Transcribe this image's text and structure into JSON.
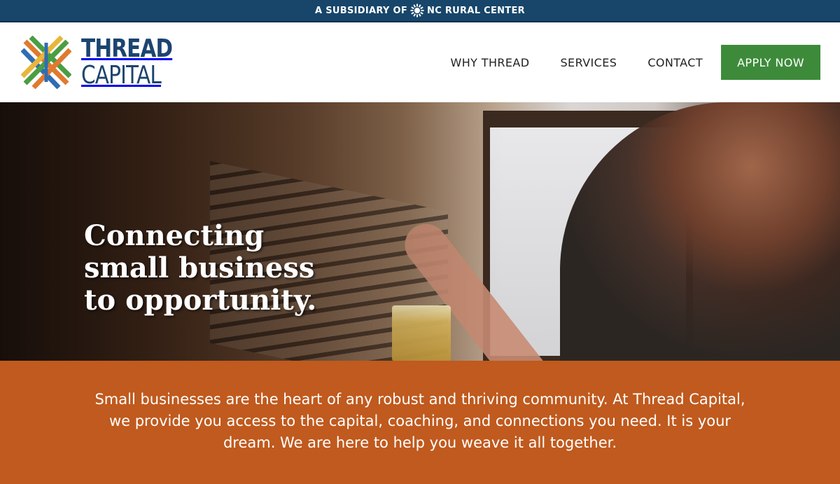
{
  "topbar": {
    "prefix": "A SUBSIDIARY OF",
    "org": "NC RURAL CENTER",
    "icon": "sunburst-icon"
  },
  "logo": {
    "line1": "THREAD",
    "line2": "CAPITAL",
    "mark_colors": [
      "#e07a2e",
      "#2f6db3",
      "#4a9e43",
      "#e8b63a"
    ]
  },
  "nav": {
    "items": [
      "WHY THREAD",
      "SERVICES",
      "CONTACT"
    ],
    "cta": "APPLY NOW"
  },
  "hero": {
    "heading_lines": [
      "Connecting",
      "small business",
      "to opportunity."
    ]
  },
  "intro": {
    "text": "Small businesses are the heart of any robust and thriving community. At Thread Capital, we provide you access to the capital, coaching, and connections you need. It is your dream. We are here to help you weave it all together."
  },
  "colors": {
    "topbar": "#17466a",
    "brand_navy": "#1c4470",
    "cta_green": "#3d8b3a",
    "intro_orange": "#c05a1e"
  }
}
